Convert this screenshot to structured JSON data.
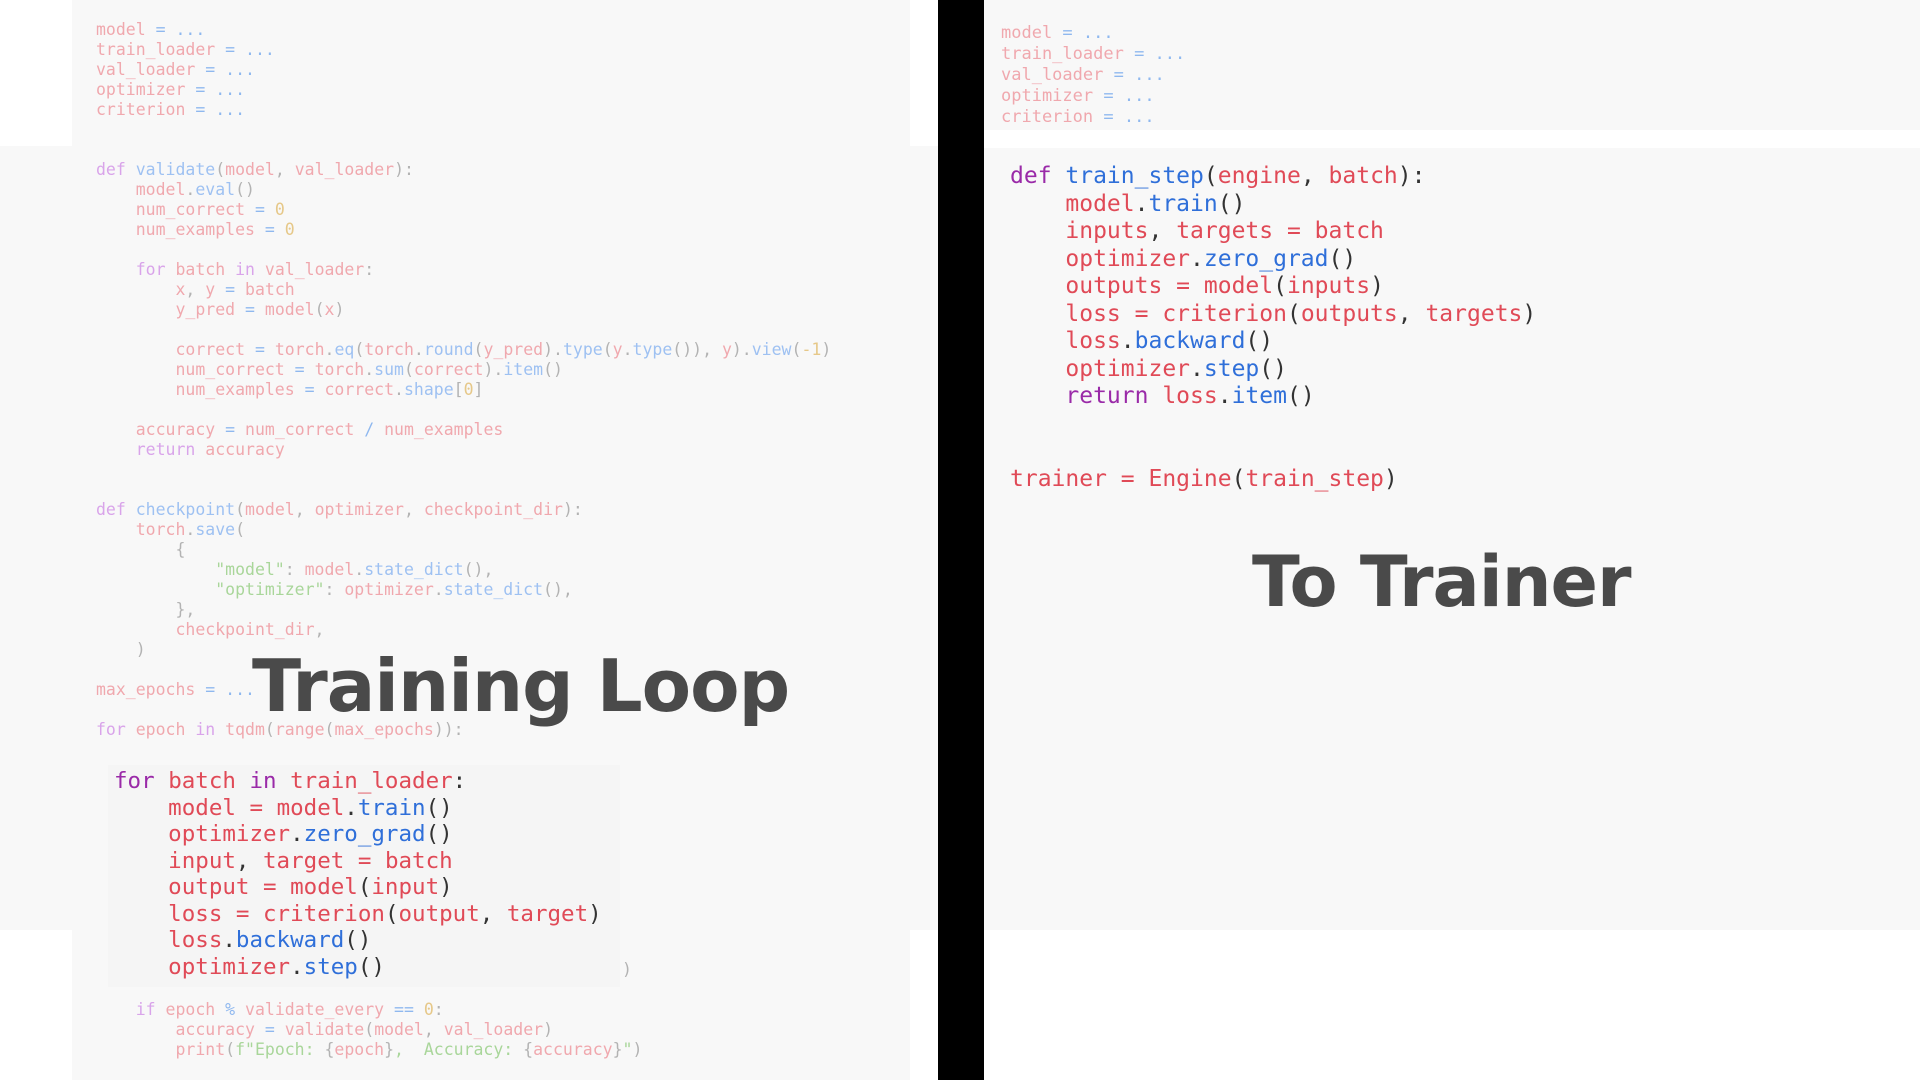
{
  "left_panel": {
    "title": "Training Loop",
    "header_code": [
      [
        [
          "model",
          "f-var"
        ],
        [
          " = ",
          "f-op"
        ],
        [
          "...",
          "f-op"
        ]
      ],
      [
        [
          "train_loader",
          "f-var"
        ],
        [
          " = ",
          "f-op"
        ],
        [
          "...",
          "f-op"
        ]
      ],
      [
        [
          "val_loader",
          "f-var"
        ],
        [
          " = ",
          "f-op"
        ],
        [
          "...",
          "f-op"
        ]
      ],
      [
        [
          "optimizer",
          "f-var"
        ],
        [
          " = ",
          "f-op"
        ],
        [
          "...",
          "f-op"
        ]
      ],
      [
        [
          "criterion",
          "f-var"
        ],
        [
          " = ",
          "f-op"
        ],
        [
          "...",
          "f-op"
        ]
      ]
    ],
    "main_code": [
      [
        [
          "def ",
          "f-kw"
        ],
        [
          "validate",
          "f-fn"
        ],
        [
          "(",
          "f-plain"
        ],
        [
          "model",
          "f-var"
        ],
        [
          ", ",
          "f-plain"
        ],
        [
          "val_loader",
          "f-var"
        ],
        [
          "):",
          "f-plain"
        ]
      ],
      [
        [
          "    model",
          "f-var"
        ],
        [
          ".",
          "f-plain"
        ],
        [
          "eval",
          "f-fn"
        ],
        [
          "()",
          "f-plain"
        ]
      ],
      [
        [
          "    num_correct",
          "f-var"
        ],
        [
          " = ",
          "f-op"
        ],
        [
          "0",
          "f-num"
        ]
      ],
      [
        [
          "    num_examples",
          "f-var"
        ],
        [
          " = ",
          "f-op"
        ],
        [
          "0",
          "f-num"
        ]
      ],
      [],
      [
        [
          "    for ",
          "f-kw"
        ],
        [
          "batch",
          "f-var"
        ],
        [
          " in ",
          "f-kw"
        ],
        [
          "val_loader",
          "f-var"
        ],
        [
          ":",
          "f-plain"
        ]
      ],
      [
        [
          "        x",
          "f-var"
        ],
        [
          ", ",
          "f-plain"
        ],
        [
          "y",
          "f-var"
        ],
        [
          " = ",
          "f-op"
        ],
        [
          "batch",
          "f-var"
        ]
      ],
      [
        [
          "        y_pred",
          "f-var"
        ],
        [
          " = ",
          "f-op"
        ],
        [
          "model",
          "f-var"
        ],
        [
          "(",
          "f-plain"
        ],
        [
          "x",
          "f-var"
        ],
        [
          ")",
          "f-plain"
        ]
      ],
      [],
      [
        [
          "        correct",
          "f-var"
        ],
        [
          " = ",
          "f-op"
        ],
        [
          "torch",
          "f-var"
        ],
        [
          ".",
          "f-plain"
        ],
        [
          "eq",
          "f-fn"
        ],
        [
          "(",
          "f-plain"
        ],
        [
          "torch",
          "f-var"
        ],
        [
          ".",
          "f-plain"
        ],
        [
          "round",
          "f-fn"
        ],
        [
          "(",
          "f-plain"
        ],
        [
          "y_pred",
          "f-var"
        ],
        [
          ").",
          "f-plain"
        ],
        [
          "type",
          "f-fn"
        ],
        [
          "(",
          "f-plain"
        ],
        [
          "y",
          "f-var"
        ],
        [
          ".",
          "f-plain"
        ],
        [
          "type",
          "f-fn"
        ],
        [
          "()), ",
          "f-plain"
        ],
        [
          "y",
          "f-var"
        ],
        [
          ").",
          "f-plain"
        ],
        [
          "view",
          "f-fn"
        ],
        [
          "(",
          "f-plain"
        ],
        [
          "-1",
          "f-num"
        ],
        [
          ")",
          "f-plain"
        ]
      ],
      [
        [
          "        num_correct",
          "f-var"
        ],
        [
          " = ",
          "f-op"
        ],
        [
          "torch",
          "f-var"
        ],
        [
          ".",
          "f-plain"
        ],
        [
          "sum",
          "f-fn"
        ],
        [
          "(",
          "f-plain"
        ],
        [
          "correct",
          "f-var"
        ],
        [
          ").",
          "f-plain"
        ],
        [
          "item",
          "f-fn"
        ],
        [
          "()",
          "f-plain"
        ]
      ],
      [
        [
          "        num_examples",
          "f-var"
        ],
        [
          " = ",
          "f-op"
        ],
        [
          "correct",
          "f-var"
        ],
        [
          ".",
          "f-plain"
        ],
        [
          "shape",
          "f-fn"
        ],
        [
          "[",
          "f-plain"
        ],
        [
          "0",
          "f-num"
        ],
        [
          "]",
          "f-plain"
        ]
      ],
      [],
      [
        [
          "    accuracy",
          "f-var"
        ],
        [
          " = ",
          "f-op"
        ],
        [
          "num_correct",
          "f-var"
        ],
        [
          " / ",
          "f-op"
        ],
        [
          "num_examples",
          "f-var"
        ]
      ],
      [
        [
          "    return ",
          "f-kw"
        ],
        [
          "accuracy",
          "f-var"
        ]
      ],
      [],
      [],
      [
        [
          "def ",
          "f-kw"
        ],
        [
          "checkpoint",
          "f-fn"
        ],
        [
          "(",
          "f-plain"
        ],
        [
          "model",
          "f-var"
        ],
        [
          ", ",
          "f-plain"
        ],
        [
          "optimizer",
          "f-var"
        ],
        [
          ", ",
          "f-plain"
        ],
        [
          "checkpoint_dir",
          "f-var"
        ],
        [
          "):",
          "f-plain"
        ]
      ],
      [
        [
          "    torch",
          "f-var"
        ],
        [
          ".",
          "f-plain"
        ],
        [
          "save",
          "f-fn"
        ],
        [
          "(",
          "f-plain"
        ]
      ],
      [
        [
          "        {",
          "f-plain"
        ]
      ],
      [
        [
          "            \"model\"",
          "f-str"
        ],
        [
          ": ",
          "f-plain"
        ],
        [
          "model",
          "f-var"
        ],
        [
          ".",
          "f-plain"
        ],
        [
          "state_dict",
          "f-fn"
        ],
        [
          "(),",
          "f-plain"
        ]
      ],
      [
        [
          "            \"optimizer\"",
          "f-str"
        ],
        [
          ": ",
          "f-plain"
        ],
        [
          "optimizer",
          "f-var"
        ],
        [
          ".",
          "f-plain"
        ],
        [
          "state_dict",
          "f-fn"
        ],
        [
          "(),",
          "f-plain"
        ]
      ],
      [
        [
          "        },",
          "f-plain"
        ]
      ],
      [
        [
          "        checkpoint_dir",
          "f-var"
        ],
        [
          ",",
          "f-plain"
        ]
      ],
      [
        [
          "    )",
          "f-plain"
        ]
      ],
      [],
      [
        [
          "max_epochs",
          "f-var"
        ],
        [
          " = ",
          "f-op"
        ],
        [
          "...",
          "f-op"
        ]
      ],
      [],
      [
        [
          "for ",
          "f-kw"
        ],
        [
          "epoch",
          "f-var"
        ],
        [
          " in ",
          "f-kw"
        ],
        [
          "tqdm",
          "f-var"
        ],
        [
          "(",
          "f-plain"
        ],
        [
          "range",
          "f-var"
        ],
        [
          "(",
          "f-plain"
        ],
        [
          "max_epochs",
          "f-var"
        ],
        [
          ")):",
          "f-plain"
        ]
      ]
    ],
    "highlight_code": [
      [
        [
          "for ",
          "s-kw"
        ],
        [
          "batch",
          "s-var"
        ],
        [
          " in ",
          "s-kw"
        ],
        [
          "train_loader",
          "s-var"
        ],
        [
          ":",
          "s-plain"
        ]
      ],
      [
        [
          "    model",
          "s-var"
        ],
        [
          " = ",
          "s-var"
        ],
        [
          "model",
          "s-var"
        ],
        [
          ".",
          "s-plain"
        ],
        [
          "train",
          "s-fn"
        ],
        [
          "()",
          "s-plain"
        ]
      ],
      [
        [
          "    optimizer",
          "s-var"
        ],
        [
          ".",
          "s-plain"
        ],
        [
          "zero_grad",
          "s-fn"
        ],
        [
          "()",
          "s-plain"
        ]
      ],
      [
        [
          "    input",
          "s-var"
        ],
        [
          ", ",
          "s-plain"
        ],
        [
          "target",
          "s-var"
        ],
        [
          " = ",
          "s-var"
        ],
        [
          "batch",
          "s-var"
        ]
      ],
      [
        [
          "    output",
          "s-var"
        ],
        [
          " = ",
          "s-var"
        ],
        [
          "model",
          "s-var"
        ],
        [
          "(",
          "s-plain"
        ],
        [
          "input",
          "s-var"
        ],
        [
          ")",
          "s-plain"
        ]
      ],
      [
        [
          "    loss",
          "s-var"
        ],
        [
          " = ",
          "s-var"
        ],
        [
          "criterion",
          "s-var"
        ],
        [
          "(",
          "s-plain"
        ],
        [
          "output",
          "s-var"
        ],
        [
          ", ",
          "s-plain"
        ],
        [
          "target",
          "s-var"
        ],
        [
          ")",
          "s-plain"
        ]
      ],
      [
        [
          "    loss",
          "s-var"
        ],
        [
          ".",
          "s-plain"
        ],
        [
          "backward",
          "s-fn"
        ],
        [
          "()",
          "s-plain"
        ]
      ],
      [
        [
          "    optimizer",
          "s-var"
        ],
        [
          ".",
          "s-plain"
        ],
        [
          "step",
          "s-fn"
        ],
        [
          "()",
          "s-plain"
        ]
      ]
    ],
    "stray_paren": ")",
    "footer_code": [
      [
        [
          "    if ",
          "f-kw"
        ],
        [
          "epoch",
          "f-var"
        ],
        [
          " % ",
          "f-op"
        ],
        [
          "validate_every",
          "f-var"
        ],
        [
          " == ",
          "f-op"
        ],
        [
          "0",
          "f-num"
        ],
        [
          ":",
          "f-plain"
        ]
      ],
      [
        [
          "        accuracy",
          "f-var"
        ],
        [
          " = ",
          "f-op"
        ],
        [
          "validate",
          "f-var"
        ],
        [
          "(",
          "f-plain"
        ],
        [
          "model",
          "f-var"
        ],
        [
          ", ",
          "f-plain"
        ],
        [
          "val_loader",
          "f-var"
        ],
        [
          ")",
          "f-plain"
        ]
      ],
      [
        [
          "        print",
          "f-var"
        ],
        [
          "(",
          "f-plain"
        ],
        [
          "f\"Epoch: ",
          "f-str"
        ],
        [
          "{",
          "f-plain"
        ],
        [
          "epoch",
          "f-var"
        ],
        [
          "}",
          "f-plain"
        ],
        [
          ",  Accuracy: ",
          "f-str"
        ],
        [
          "{",
          "f-plain"
        ],
        [
          "accuracy",
          "f-var"
        ],
        [
          "}",
          "f-plain"
        ],
        [
          "\"",
          "f-str"
        ],
        [
          ")",
          "f-plain"
        ]
      ]
    ]
  },
  "right_panel": {
    "title": "To Trainer",
    "header_code": [
      [
        [
          "model",
          "f-var"
        ],
        [
          " = ",
          "f-op"
        ],
        [
          "...",
          "f-op"
        ]
      ],
      [
        [
          "train_loader",
          "f-var"
        ],
        [
          " = ",
          "f-op"
        ],
        [
          "...",
          "f-op"
        ]
      ],
      [
        [
          "val_loader",
          "f-var"
        ],
        [
          " = ",
          "f-op"
        ],
        [
          "...",
          "f-op"
        ]
      ],
      [
        [
          "optimizer",
          "f-var"
        ],
        [
          " = ",
          "f-op"
        ],
        [
          "...",
          "f-op"
        ]
      ],
      [
        [
          "criterion",
          "f-var"
        ],
        [
          " = ",
          "f-op"
        ],
        [
          "...",
          "f-op"
        ]
      ]
    ],
    "main_code": [
      [
        [
          "def ",
          "s-kw"
        ],
        [
          "train_step",
          "s-fn"
        ],
        [
          "(",
          "s-plain"
        ],
        [
          "engine",
          "s-var"
        ],
        [
          ", ",
          "s-plain"
        ],
        [
          "batch",
          "s-var"
        ],
        [
          "):",
          "s-plain"
        ]
      ],
      [
        [
          "    model",
          "s-var"
        ],
        [
          ".",
          "s-plain"
        ],
        [
          "train",
          "s-fn"
        ],
        [
          "()",
          "s-plain"
        ]
      ],
      [
        [
          "    inputs",
          "s-var"
        ],
        [
          ", ",
          "s-plain"
        ],
        [
          "targets",
          "s-var"
        ],
        [
          " = ",
          "s-var"
        ],
        [
          "batch",
          "s-var"
        ]
      ],
      [
        [
          "    optimizer",
          "s-var"
        ],
        [
          ".",
          "s-plain"
        ],
        [
          "zero_grad",
          "s-fn"
        ],
        [
          "()",
          "s-plain"
        ]
      ],
      [
        [
          "    outputs",
          "s-var"
        ],
        [
          " = ",
          "s-var"
        ],
        [
          "model",
          "s-var"
        ],
        [
          "(",
          "s-plain"
        ],
        [
          "inputs",
          "s-var"
        ],
        [
          ")",
          "s-plain"
        ]
      ],
      [
        [
          "    loss",
          "s-var"
        ],
        [
          " = ",
          "s-var"
        ],
        [
          "criterion",
          "s-var"
        ],
        [
          "(",
          "s-plain"
        ],
        [
          "outputs",
          "s-var"
        ],
        [
          ", ",
          "s-plain"
        ],
        [
          "targets",
          "s-var"
        ],
        [
          ")",
          "s-plain"
        ]
      ],
      [
        [
          "    loss",
          "s-var"
        ],
        [
          ".",
          "s-plain"
        ],
        [
          "backward",
          "s-fn"
        ],
        [
          "()",
          "s-plain"
        ]
      ],
      [
        [
          "    optimizer",
          "s-var"
        ],
        [
          ".",
          "s-plain"
        ],
        [
          "step",
          "s-fn"
        ],
        [
          "()",
          "s-plain"
        ]
      ],
      [
        [
          "    return ",
          "s-kw"
        ],
        [
          "loss",
          "s-var"
        ],
        [
          ".",
          "s-plain"
        ],
        [
          "item",
          "s-fn"
        ],
        [
          "()",
          "s-plain"
        ]
      ],
      [],
      [],
      [
        [
          "trainer",
          "s-var"
        ],
        [
          " = ",
          "s-var"
        ],
        [
          "Engine",
          "s-var"
        ],
        [
          "(",
          "s-plain"
        ],
        [
          "train_step",
          "s-var"
        ],
        [
          ")",
          "s-plain"
        ]
      ]
    ]
  },
  "colors": {
    "panel_bg": "#f8f8f8",
    "divider": "#000000",
    "title": "#4a4a4a"
  }
}
